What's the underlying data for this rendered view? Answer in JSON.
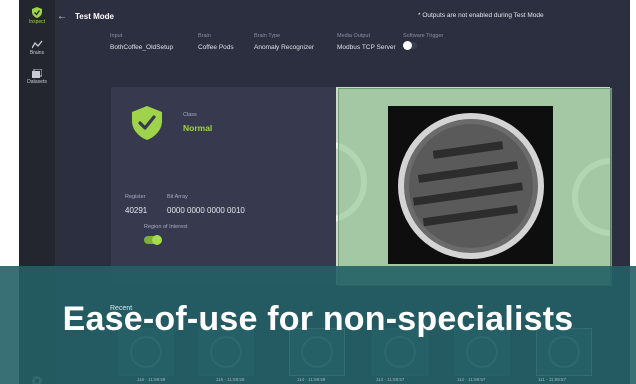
{
  "sidebar": {
    "items": [
      {
        "label": "Inspect",
        "icon": "shield-icon"
      },
      {
        "label": "Brains",
        "icon": "chart-icon"
      },
      {
        "label": "Datasets",
        "icon": "images-icon"
      }
    ],
    "settings_icon": "gear-icon"
  },
  "header": {
    "back_icon": "arrow-left-icon",
    "title": "Test Mode",
    "notice": "* Outputs are not enabled during Test Mode"
  },
  "settings": {
    "input": {
      "label": "Input",
      "value": "BothCoffee_OldSetup"
    },
    "brain": {
      "label": "Brain",
      "value": "Coffee Pods"
    },
    "brain_type": {
      "label": "Brain Type",
      "value": "Anomaly Recognizer"
    },
    "media_output": {
      "label": "Media Output",
      "value": "Modbus TCP Server"
    },
    "software_trigger": {
      "label": "Software Trigger",
      "enabled": false
    }
  },
  "result": {
    "class_label": "Class",
    "class_value": "Normal",
    "register_label": "Register",
    "register_value": "40291",
    "bit_array_label": "Bit Array",
    "bit_array_value": "0000 0000 0000 0010",
    "roi_label": "Region of Interest",
    "roi_enabled": true
  },
  "recent": {
    "label": "Recent",
    "thumbnails": [
      {
        "time": "116 - 11:59:58"
      },
      {
        "time": "115 - 11:59:58"
      },
      {
        "time": "114 - 11:59:58"
      },
      {
        "time": "113 - 11:59:57"
      },
      {
        "time": "112 - 11:59:57"
      },
      {
        "time": "111 - 11:59:57"
      }
    ]
  },
  "banner": {
    "text": "Ease-of-use for non-specialists"
  },
  "colors": {
    "accent": "#9fd34a",
    "background": "#2c2f3f",
    "sidebar": "#23252f",
    "banner": "#246066"
  }
}
